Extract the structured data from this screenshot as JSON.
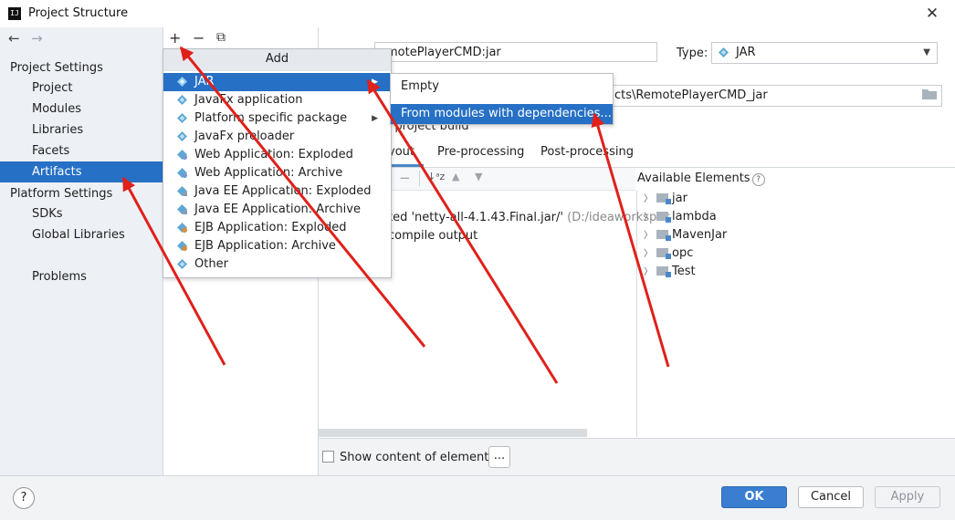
{
  "window": {
    "title": "Project Structure",
    "logo": "IJ"
  },
  "nav": {
    "back": "←",
    "forward": "→"
  },
  "sidebar": {
    "project_settings_title": "Project Settings",
    "project_items": [
      "Project",
      "Modules",
      "Libraries",
      "Facets",
      "Artifacts"
    ],
    "platform_settings_title": "Platform Settings",
    "platform_items": [
      "SDKs",
      "Global Libraries"
    ],
    "problems": "Problems",
    "selected": "Artifacts"
  },
  "toolbar": {
    "add": "+",
    "remove": "−",
    "copy": "⧉"
  },
  "artifact": {
    "name": "emotePlayerCMD:jar",
    "type_label": "Type:",
    "type_value": "JAR",
    "output_dir": "cts\\RemotePlayerCMD_jar",
    "build_label": "n project build"
  },
  "tabs": [
    "yout",
    "Pre-processing",
    "Post-processing"
  ],
  "output_tree": {
    "lines": [
      {
        "text": "ted 'netty-all-4.1.43.Final.jar/'",
        "path": " (D:/ideaworkspac"
      },
      {
        "text": "compile output",
        "path": ""
      }
    ]
  },
  "available": {
    "title": "Available Elements",
    "help": "?",
    "items": [
      "jar",
      "lambda",
      "MavenJar",
      "opc",
      "Test"
    ]
  },
  "options": {
    "show_content_label": "Show content of elements",
    "dots": "..."
  },
  "add_menu": {
    "header": "Add",
    "items": [
      "JAR",
      "JavaFx application",
      "Platform specific package",
      "JavaFx preloader",
      "Web Application: Exploded",
      "Web Application: Archive",
      "Java EE Application: Exploded",
      "Java EE Application: Archive",
      "EJB Application: Exploded",
      "EJB Application: Archive",
      "Other"
    ]
  },
  "submenu": {
    "items": [
      "Empty",
      "From modules with dependencies..."
    ]
  },
  "footer": {
    "help": "?",
    "ok": "OK",
    "cancel": "Cancel",
    "apply": "Apply"
  },
  "colors": {
    "selection": "#2670c5",
    "annotation_arrow": "#e0201a",
    "ok_button": "#3a7ed1"
  }
}
